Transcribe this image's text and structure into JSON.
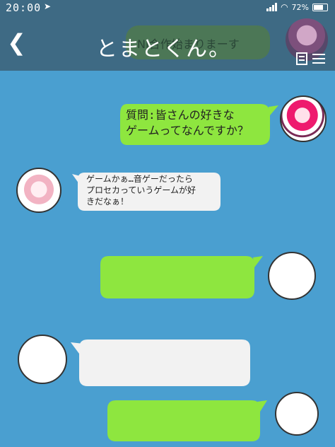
{
  "status": {
    "time": "20:00",
    "battery": "72%",
    "battery_level": 0.72
  },
  "header": {
    "title": "とまとくん。",
    "background_message": "NI合作始まりまーす"
  },
  "messages": [
    {
      "side": "right",
      "color": "#8ee63f",
      "text": "質問:皆さんの好きな\nゲームってなんですか？"
    },
    {
      "side": "left",
      "color": "#f2f2f2",
      "text": "ゲームかぁ…音ゲーだったら\nプロセカっていうゲームが好\nきだなぁ！"
    },
    {
      "side": "right",
      "color": "#8ee63f",
      "text": ""
    },
    {
      "side": "left",
      "color": "#f2f2f2",
      "text": ""
    },
    {
      "side": "right",
      "color": "#8ee63f",
      "text": ""
    }
  ],
  "colors": {
    "header": "#3e6a84",
    "background": "#4a9fd0",
    "green_bubble": "#8ee63f",
    "white_bubble": "#f2f2f2"
  },
  "icons": [
    "back-icon",
    "menu-icon",
    "location-arrow-icon",
    "signal-icon",
    "wifi-icon",
    "battery-icon"
  ]
}
